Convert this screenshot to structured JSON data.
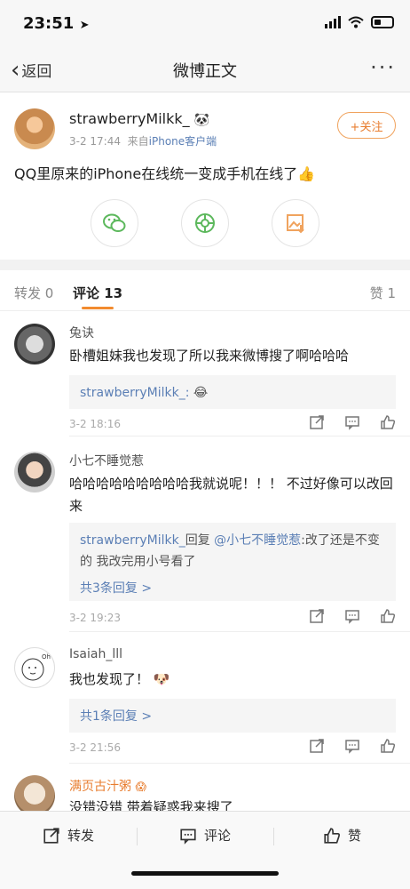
{
  "status_bar": {
    "time": "23:51"
  },
  "nav": {
    "back_label": "返回",
    "title": "微博正文"
  },
  "post": {
    "author": "strawberryMilkk_",
    "date": "3-2 17:44",
    "source_prefix": "来自",
    "source": "iPhone客户端",
    "follow_label": "+关注",
    "text": "QQ里原来的iPhone在线统一变成手机在线了"
  },
  "tabs": {
    "repost": "转发 0",
    "comment": "评论 13",
    "like": "赞 1"
  },
  "comments": [
    {
      "name": "兔诀",
      "text": "卧槽姐妹我也发现了所以我来微博搜了啊哈哈哈",
      "reply_author": "strawberryMilkk_:",
      "time": "3-2 18:16"
    },
    {
      "name": "小七不睡觉惹",
      "text": "哈哈哈哈哈哈哈哈哈我就说呢！！！ 不过好像可以改回来",
      "reply_author": "strawberryMilkk_",
      "reply_mid": "回复",
      "reply_mention": "@小七不睡觉惹",
      "reply_text": ":改了还是不变的 我改完用小号看了",
      "reply_count": "共3条回复 >",
      "time": "3-2 19:23"
    },
    {
      "name": "Isaiah_lll",
      "text": "我也发现了！",
      "reply_count": "共1条回复 >",
      "time": "3-2 21:56"
    },
    {
      "name": "满页古汁粥",
      "text": "没错没错 带着疑惑我来搜了"
    }
  ],
  "bottom_bar": {
    "repost": "转发",
    "comment": "评论",
    "like": "赞"
  },
  "colors": {
    "accent": "#f28b2f",
    "link": "#5b7fb5"
  }
}
